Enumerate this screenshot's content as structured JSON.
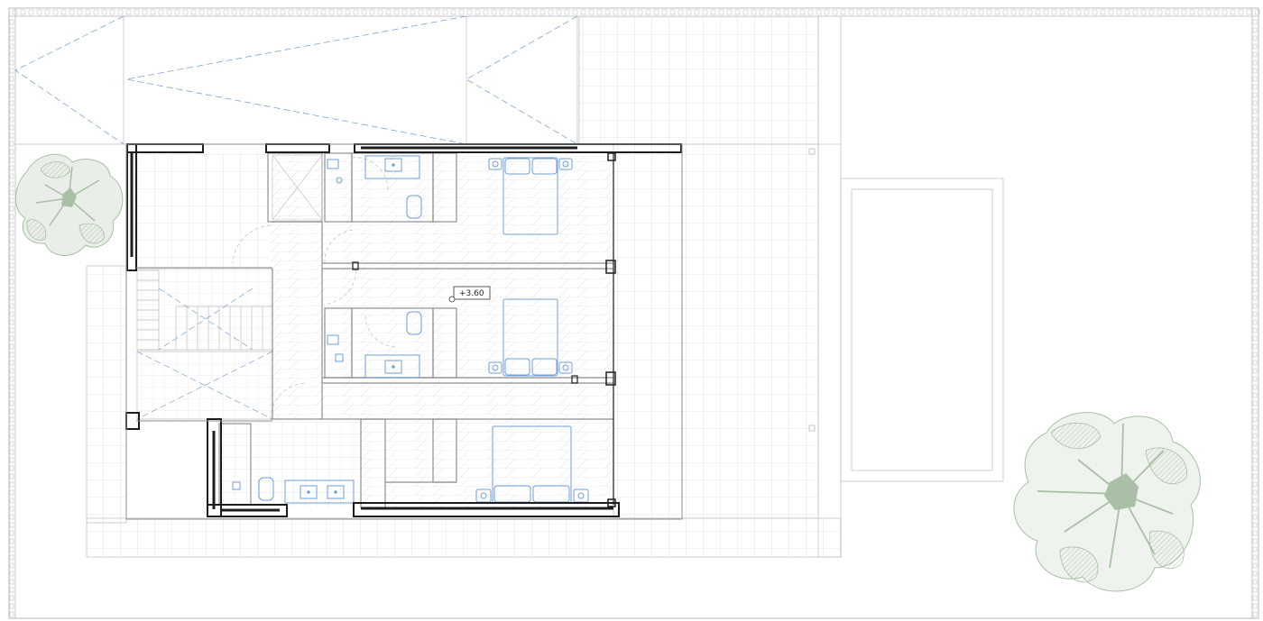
{
  "plan": {
    "level_label": "+3.60"
  },
  "colors": {
    "line": "#b9b9b9",
    "wall": "#1d1d1d",
    "fixture": "#6f9fd6",
    "dash": "#7ea3d8",
    "tree": "#a9bfa6",
    "tree_dark": "#8faa8b"
  }
}
